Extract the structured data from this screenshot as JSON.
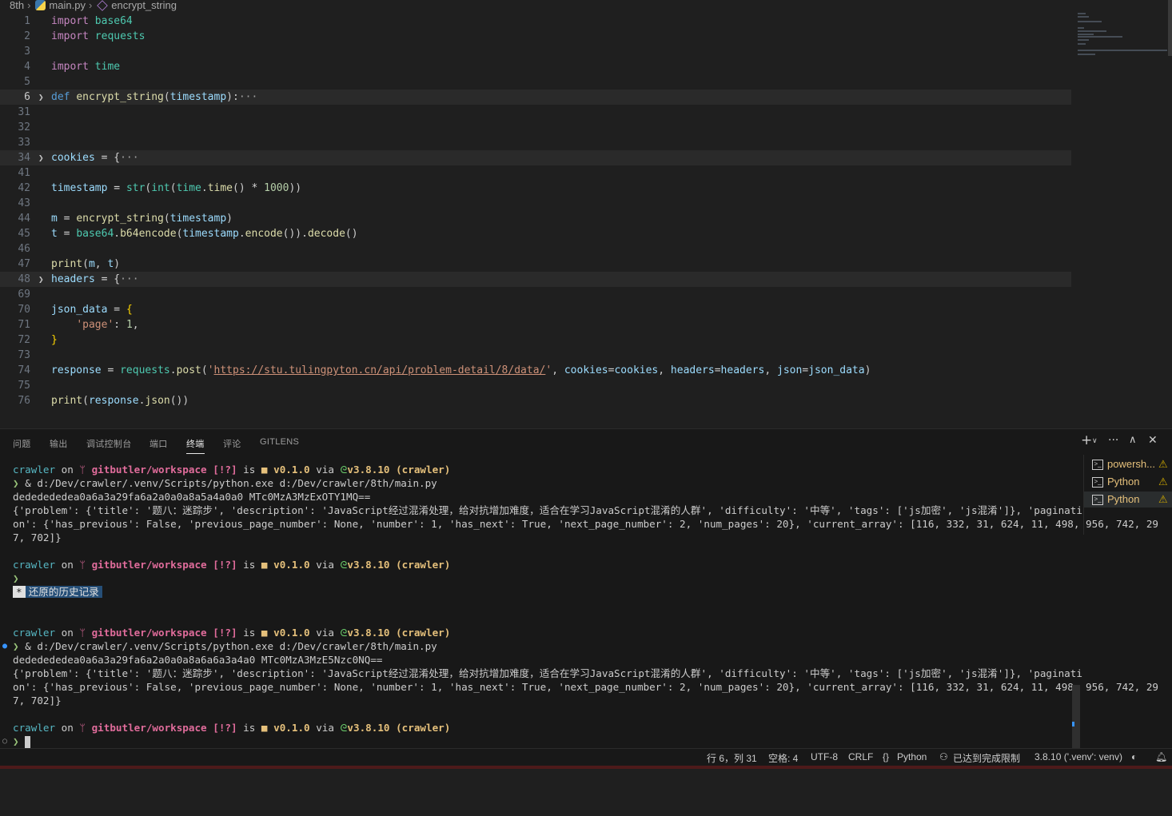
{
  "breadcrumb": {
    "folder": "8th",
    "file": "main.py",
    "symbol": "encrypt_string"
  },
  "editor": {
    "lines": [
      {
        "n": "1",
        "cur": false,
        "fold": false
      },
      {
        "n": "2"
      },
      {
        "n": "3"
      },
      {
        "n": "4"
      },
      {
        "n": "5"
      },
      {
        "n": "6",
        "cur": true
      },
      {
        "n": "31"
      },
      {
        "n": "32"
      },
      {
        "n": "33"
      },
      {
        "n": "34"
      },
      {
        "n": "41"
      },
      {
        "n": "42"
      },
      {
        "n": "43"
      },
      {
        "n": "44"
      },
      {
        "n": "45"
      },
      {
        "n": "46"
      },
      {
        "n": "47"
      },
      {
        "n": "48"
      },
      {
        "n": "69"
      },
      {
        "n": "70"
      },
      {
        "n": "71"
      },
      {
        "n": "72"
      },
      {
        "n": "73"
      },
      {
        "n": "74"
      },
      {
        "n": "75"
      },
      {
        "n": "76"
      }
    ],
    "code": {
      "l1_kw": "import",
      "l1_mod": "base64",
      "l2_kw": "import",
      "l2_mod": "requests",
      "l4_kw": "import",
      "l4_mod": "time",
      "l6_kw": "def",
      "l6_fn": "encrypt_string",
      "l6_p1": "(",
      "l6_arg": "timestamp",
      "l6_p2": "):",
      "l6_ell": "···",
      "l34_var": "cookies",
      "l34_op": " = {",
      "l34_ell": "···",
      "l42_var": "timestamp",
      "l42_op": " = ",
      "l42_f1": "str",
      "l42_f2": "int",
      "l42_m": "time",
      "l42_f3": "time",
      "l42_num": "1000",
      "l44_var": "m",
      "l44_fn": "encrypt_string",
      "l44_arg": "timestamp",
      "l45_var": "t",
      "l45_mod": "base64",
      "l45_fn": "b64encode",
      "l45_arg": "timestamp",
      "l45_fn2": "encode",
      "l45_fn3": "decode",
      "l47_fn": "print",
      "l47_a": "m",
      "l47_b": "t",
      "l48_var": "headers",
      "l48_ell": "···",
      "l70_var": "json_data",
      "l71_str": "'page'",
      "l71_num": "1",
      "l74_var": "response",
      "l74_mod": "requests",
      "l74_fn": "post",
      "l74_url": "https://stu.tulingpyton.cn/api/problem-detail/8/data/",
      "l74_k1": "cookies",
      "l74_v1": "cookies",
      "l74_k2": "headers",
      "l74_v2": "headers",
      "l74_k3": "json",
      "l74_v3": "json_data",
      "l76_fn": "print",
      "l76_var": "response",
      "l76_fn2": "json"
    }
  },
  "panel": {
    "tabs": [
      "问题",
      "输出",
      "调试控制台",
      "端口",
      "终端",
      "评论",
      "GITLENS"
    ],
    "active_tab": "终端"
  },
  "terminal": {
    "prompt_user": "crawler",
    "prompt_on": " on ",
    "prompt_branch_icon": "ᛘ",
    "prompt_branch": "gitbutler/workspace",
    "prompt_status": "[!?]",
    "prompt_is": " is ",
    "prompt_pkg": "v0.1.0",
    "prompt_via": " via ",
    "prompt_py": "v3.8.10",
    "prompt_env": "(crawler)",
    "cmd": "& d:/Dev/crawler/.venv/Scripts/python.exe d:/Dev/crawler/8th/main.py",
    "out1_a": "dededededea0a6a3a29fa6a2a0a0a8a5a4a0a0 MTc0MzA3MzExOTY1MQ==",
    "out1_b": "dededededea0a6a3a29fa6a2a0a0a8a6a6a3a4a0 MTc0MzA3MzE5Nzc0NQ==",
    "json_l1": "{'problem': {'title': '题八：迷踪步', 'description': 'JavaScript经过混淆处理，给对抗增加难度，适合在学习JavaScript混淆的人群', 'difficulty': '中等', 'tags': ['js加密', 'js混淆']}, 'paginati",
    "json_l2": "on': {'has_previous': False, 'previous_page_number': None, 'number': 1, 'has_next': True, 'next_page_number': 2, 'num_pages': 20}, 'current_array': [116, 332, 31, 624, 11, 498, 956, 742, 29",
    "json_l3": "7, 702]}",
    "restored_star": "*",
    "restored": "还原的历史记录",
    "list": [
      {
        "label": "powersh...",
        "warn": "⚠"
      },
      {
        "label": "Python",
        "warn": "⚠"
      },
      {
        "label": "Python",
        "warn": "⚠"
      }
    ]
  },
  "statusbar": {
    "position": "行 6，列 31",
    "spaces": "空格: 4",
    "encoding": "UTF-8",
    "eol": "CRLF",
    "lang_braces": "{}",
    "language": "Python",
    "copilot": "已达到完成限制",
    "interpreter": "3.8.10 ('.venv': venv)"
  }
}
